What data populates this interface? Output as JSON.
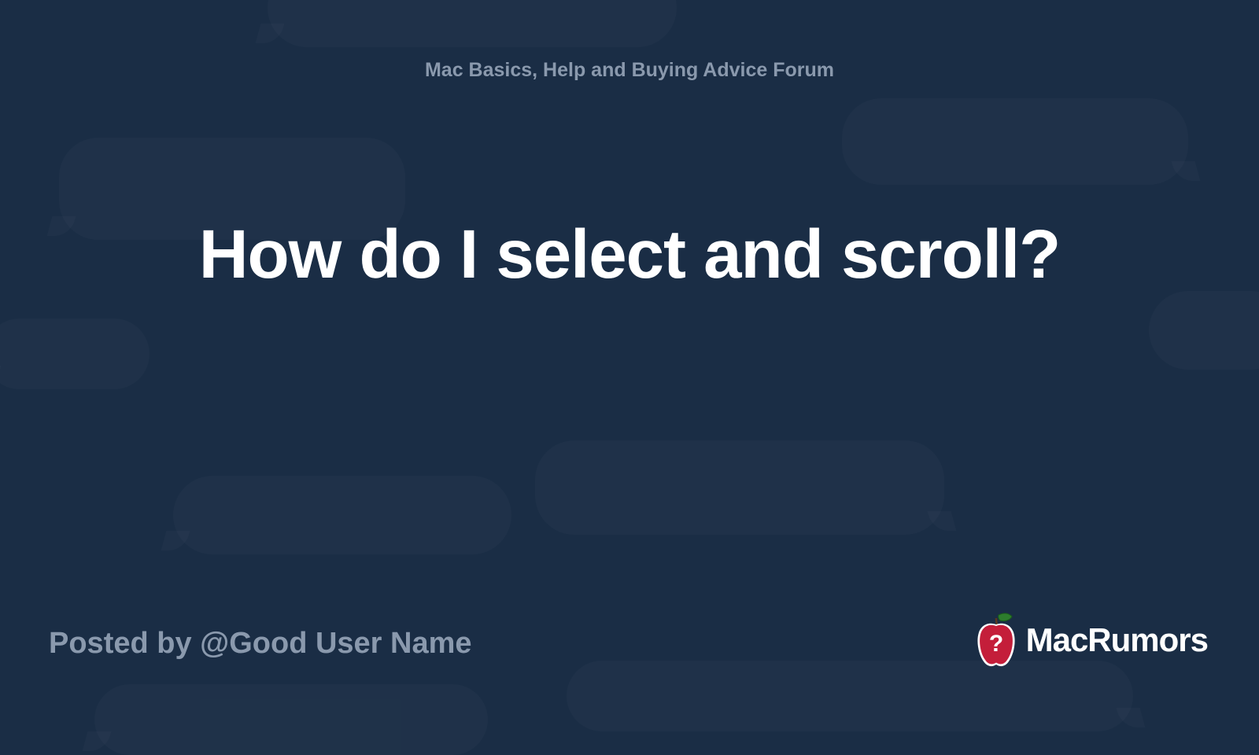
{
  "forum_name": "Mac Basics, Help and Buying Advice Forum",
  "thread_title": "How do I select and scroll?",
  "posted_by": "Posted by @Good User Name",
  "site_name": "MacRumors",
  "colors": {
    "background": "#1a2d45",
    "text_muted": "#8a99ad",
    "text_primary": "#ffffff",
    "apple_red": "#c41e3a",
    "apple_green": "#2d7d2d"
  }
}
